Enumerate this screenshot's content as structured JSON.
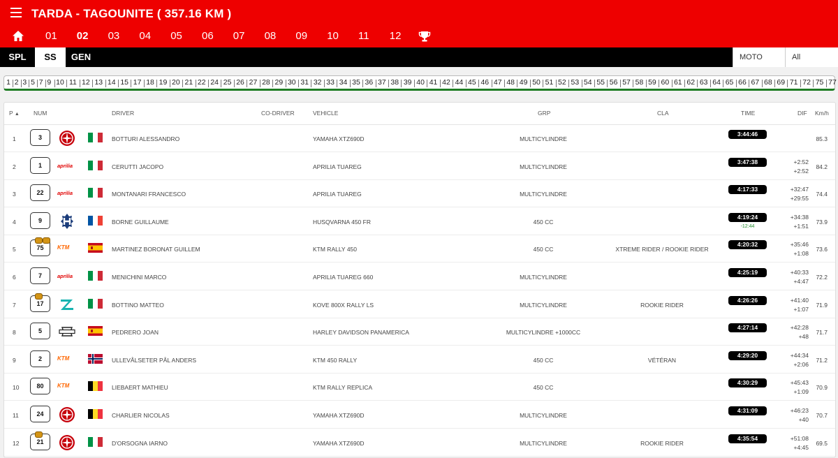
{
  "header": {
    "title": "TARDA - TAGOUNITE ( 357.16 KM )",
    "stages": [
      "01",
      "02",
      "03",
      "04",
      "05",
      "06",
      "07",
      "08",
      "09",
      "10",
      "11",
      "12"
    ],
    "active_stage": "02"
  },
  "tabs": [
    "SPL",
    "SS",
    "GEN"
  ],
  "active_tab": "SS",
  "filters": {
    "category": "MOTO",
    "class": "All"
  },
  "km_markers": [
    "1",
    "2",
    "3",
    "5",
    "7",
    "9",
    "10",
    "11",
    "12",
    "13",
    "14",
    "15",
    "17",
    "18",
    "19",
    "20",
    "21",
    "22",
    "24",
    "25",
    "26",
    "27",
    "28",
    "29",
    "30",
    "31",
    "32",
    "33",
    "34",
    "35",
    "36",
    "37",
    "38",
    "39",
    "40",
    "41",
    "42",
    "44",
    "45",
    "46",
    "47",
    "48",
    "49",
    "50",
    "51",
    "52",
    "53",
    "54",
    "55",
    "56",
    "57",
    "58",
    "59",
    "60",
    "61",
    "62",
    "63",
    "64",
    "65",
    "66",
    "67",
    "68",
    "69",
    "71",
    "72",
    "75",
    "77"
  ],
  "columns": {
    "p": "P",
    "num": "NUM",
    "driver": "DRIVER",
    "codriver": "CO-DRIVER",
    "vehicle": "VEHICLE",
    "grp": "GRP",
    "cla": "CLA",
    "time": "TIME",
    "dif": "DIF",
    "kmh": "Km/h"
  },
  "rows": [
    {
      "p": "1",
      "num": "3",
      "brand": "yamaha",
      "flag": "italy",
      "driver": "BOTTURI ALESSANDRO",
      "vehicle": "YAMAHA XTZ690D",
      "grp": "MULTICYLINDRE",
      "cla": "",
      "time": "3:44:46",
      "gain": "",
      "dif1": "",
      "dif2": "",
      "kmh": "85.3",
      "badges": 0
    },
    {
      "p": "2",
      "num": "1",
      "brand": "aprilia",
      "flag": "italy",
      "driver": "CERUTTI JACOPO",
      "vehicle": "APRILIA TUAREG",
      "grp": "MULTICYLINDRE",
      "cla": "",
      "time": "3:47:38",
      "gain": "",
      "dif1": "+2:52",
      "dif2": "+2:52",
      "kmh": "84.2",
      "badges": 0
    },
    {
      "p": "3",
      "num": "22",
      "brand": "aprilia",
      "flag": "italy",
      "driver": "MONTANARI FRANCESCO",
      "vehicle": "APRILIA TUAREG",
      "grp": "MULTICYLINDRE",
      "cla": "",
      "time": "4:17:33",
      "gain": "",
      "dif1": "+32:47",
      "dif2": "+29:55",
      "kmh": "74.4",
      "badges": 0
    },
    {
      "p": "4",
      "num": "9",
      "brand": "husqvarna",
      "flag": "france",
      "driver": "BORNE GUILLAUME",
      "vehicle": "HUSQVARNA 450 FR",
      "grp": "450 CC",
      "cla": "",
      "time": "4:19:24",
      "gain": "-12:44",
      "dif1": "+34:38",
      "dif2": "+1:51",
      "kmh": "73.9",
      "badges": 0
    },
    {
      "p": "5",
      "num": "75",
      "brand": "ktm",
      "flag": "spain",
      "driver": "MARTINEZ BORONAT GUILLEM",
      "vehicle": "KTM RALLY 450",
      "grp": "450 CC",
      "cla": "XTREME RIDER / ROOKIE RIDER",
      "time": "4:20:32",
      "gain": "",
      "dif1": "+35:46",
      "dif2": "+1:08",
      "kmh": "73.6",
      "badges": 2
    },
    {
      "p": "6",
      "num": "7",
      "brand": "aprilia",
      "flag": "italy",
      "driver": "MENICHINI MARCO",
      "vehicle": "APRILIA TUAREG 660",
      "grp": "MULTICYLINDRE",
      "cla": "",
      "time": "4:25:19",
      "gain": "",
      "dif1": "+40:33",
      "dif2": "+4:47",
      "kmh": "72.2",
      "badges": 0
    },
    {
      "p": "7",
      "num": "17",
      "brand": "kove",
      "flag": "italy",
      "driver": "BOTTINO MATTEO",
      "vehicle": "KOVE 800X RALLY LS",
      "grp": "MULTICYLINDRE",
      "cla": "ROOKIE RIDER",
      "time": "4:26:26",
      "gain": "",
      "dif1": "+41:40",
      "dif2": "+1:07",
      "kmh": "71.9",
      "badges": 1
    },
    {
      "p": "8",
      "num": "5",
      "brand": "harley",
      "flag": "spain",
      "driver": "PEDRERO JOAN",
      "vehicle": "HARLEY DAVIDSON PANAMERICA",
      "grp": "MULTICYLINDRE +1000CC",
      "cla": "",
      "time": "4:27:14",
      "gain": "",
      "dif1": "+42:28",
      "dif2": "+48",
      "kmh": "71.7",
      "badges": 0
    },
    {
      "p": "9",
      "num": "2",
      "brand": "ktm",
      "flag": "norway",
      "driver": "ULLEVÅLSETER PÅL ANDERS",
      "vehicle": "KTM 450 RALLY",
      "grp": "450 CC",
      "cla": "VÉTÉRAN",
      "time": "4:29:20",
      "gain": "",
      "dif1": "+44:34",
      "dif2": "+2:06",
      "kmh": "71.2",
      "badges": 0
    },
    {
      "p": "10",
      "num": "80",
      "brand": "ktm",
      "flag": "belgium",
      "driver": "LIEBAERT MATHIEU",
      "vehicle": "KTM RALLY REPLICA",
      "grp": "450 CC",
      "cla": "",
      "time": "4:30:29",
      "gain": "",
      "dif1": "+45:43",
      "dif2": "+1:09",
      "kmh": "70.9",
      "badges": 0
    },
    {
      "p": "11",
      "num": "24",
      "brand": "yamaha",
      "flag": "belgium",
      "driver": "CHARLIER NICOLAS",
      "vehicle": "YAMAHA XTZ690D",
      "grp": "MULTICYLINDRE",
      "cla": "",
      "time": "4:31:09",
      "gain": "",
      "dif1": "+46:23",
      "dif2": "+40",
      "kmh": "70.7",
      "badges": 0
    },
    {
      "p": "12",
      "num": "21",
      "brand": "yamaha",
      "flag": "italy",
      "driver": "D'ORSOGNA IARNO",
      "vehicle": "YAMAHA XTZ690D",
      "grp": "MULTICYLINDRE",
      "cla": "ROOKIE RIDER",
      "time": "4:35:54",
      "gain": "",
      "dif1": "+51:08",
      "dif2": "+4:45",
      "kmh": "69.5",
      "badges": 1
    }
  ],
  "brand_text": {
    "aprilia": "aprilia",
    "ktm": "KTM"
  },
  "colors": {
    "header_red": "#ee0000",
    "time_badge": "#000000",
    "gain_green": "#1e8a2a",
    "ruler_green": "#1e7d23"
  }
}
